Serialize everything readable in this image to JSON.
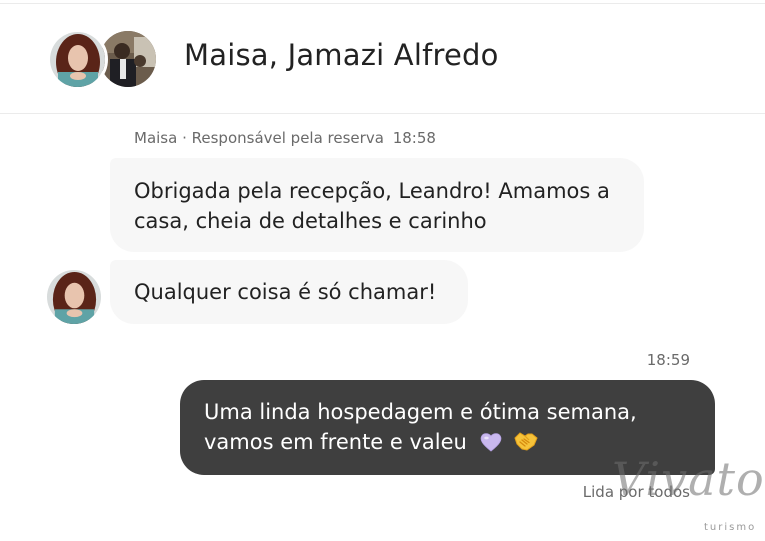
{
  "header": {
    "title": "Maisa, Jamazi Alfredo"
  },
  "messages": [
    {
      "sender": "Maisa",
      "role": "· Responsável pela reserva",
      "time": "18:58",
      "text": "Obrigada pela recepção, Leandro! Amamos a casa, cheia de detalhes e carinho"
    },
    {
      "text": "Qualquer coisa é só chamar!"
    },
    {
      "time": "18:59",
      "text": "Uma linda hospedagem e ótima semana, vamos em frente e valeu",
      "emojis": [
        "purple-heart-icon",
        "handshake-icon"
      ]
    }
  ],
  "read_receipt": "Lida por todos",
  "watermark": {
    "brand": "Vivato",
    "sub": "turismo"
  },
  "colors": {
    "incoming_bubble": "#f7f7f7",
    "outgoing_bubble": "#3f3f3f",
    "meta_text": "#6a6a6a",
    "divider": "#ebebeb"
  }
}
